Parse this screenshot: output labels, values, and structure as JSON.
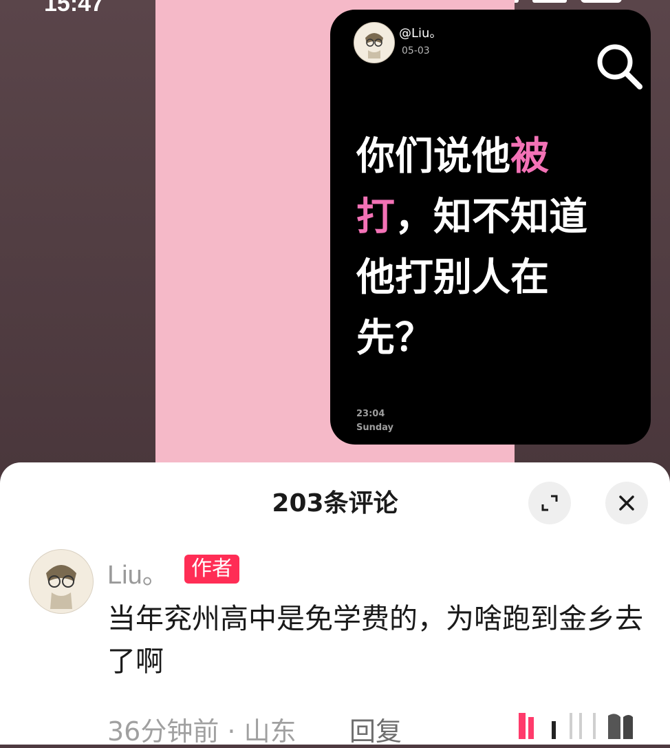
{
  "status_bar": {
    "time_fragment": "15:47"
  },
  "post": {
    "username": "@Liu。",
    "date": "05-03",
    "headline": {
      "part1": "你们说他",
      "highlight1": "被",
      "highlight2": "打",
      "part2": "，知不知道",
      "line3": "他打别人在",
      "line4": "先？"
    },
    "footer_time": "23:04",
    "footer_day": "Sunday"
  },
  "comments_sheet": {
    "title": "203条评论",
    "comment": {
      "username": "Liu。",
      "author_badge": "作者",
      "text": "当年兖州高中是免学费的，为啥跑到金乡去了啊",
      "meta": "36分钟前 · 山东",
      "reply_label": "回复"
    }
  },
  "colors": {
    "background": "#4e3a40",
    "pink_panel": "#f5b9c8",
    "card": "#000000",
    "highlight": "#f372b6",
    "author_badge": "#ff2d55"
  },
  "icons": [
    "search-icon",
    "expand-icon",
    "close-icon",
    "avatar-illustration"
  ]
}
